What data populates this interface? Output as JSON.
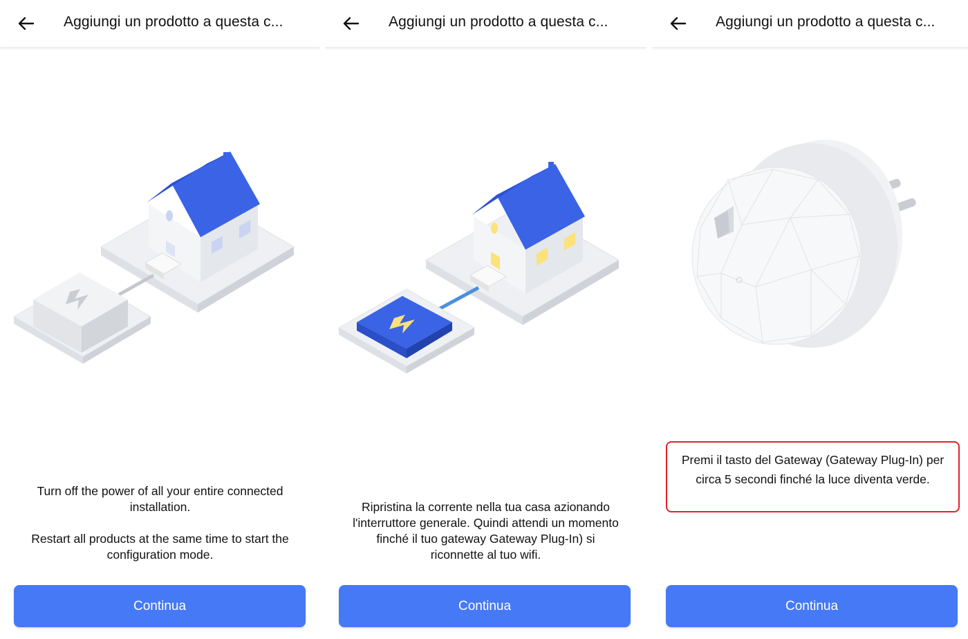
{
  "screens": [
    {
      "title": "Aggiungi un prodotto a questa c...",
      "illustration": "house-power-off-illustration",
      "text_lines": [
        "Turn off the power of all your entire connected installation.",
        "Restart all products at the same time to start the configuration mode."
      ],
      "button_label": "Continua"
    },
    {
      "title": "Aggiungi un prodotto a questa c...",
      "illustration": "house-power-on-illustration",
      "text_lines": [
        "Ripristina la corrente nella tua casa azionando l'interruttore generale. Quindi attendi un momento finché il tuo gateway Gateway Plug-In) si riconnette al tuo wifi."
      ],
      "button_label": "Continua"
    },
    {
      "title": "Aggiungi un prodotto a questa c...",
      "illustration": "gateway-plug-in-device",
      "highlighted_text": "Premi il tasto del Gateway (Gateway Plug-In) per circa 5 secondi finché la luce diventa verde.",
      "button_label": "Continua"
    }
  ],
  "colors": {
    "accent_blue": "#4579f5",
    "house_roof": "#3a63e6",
    "highlight_border": "#e0202a",
    "window_lit": "#fbe27a"
  },
  "icons": {
    "back": "arrow-left-icon",
    "power": "lightning-bolt-icon"
  }
}
